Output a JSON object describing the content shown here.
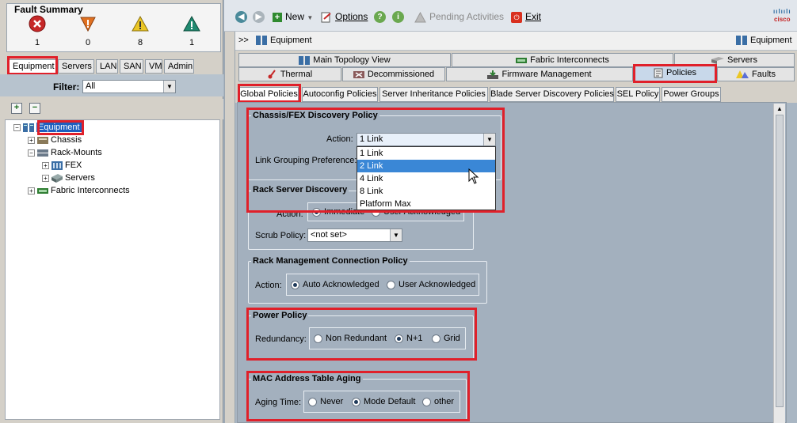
{
  "fault_summary": {
    "title": "Fault Summary",
    "items": [
      {
        "icon": "critical-icon",
        "count": "1",
        "color": "#c62828"
      },
      {
        "icon": "major-icon",
        "count": "0",
        "color": "#e07020"
      },
      {
        "icon": "minor-icon",
        "count": "8",
        "color": "#e8c020"
      },
      {
        "icon": "warning-icon",
        "count": "1",
        "color": "#1f8a70"
      }
    ]
  },
  "left_tabs": [
    "Equipment",
    "Servers",
    "LAN",
    "SAN",
    "VM",
    "Admin"
  ],
  "filter": {
    "label": "Filter:",
    "value": "All"
  },
  "tree": {
    "root": "Equipment",
    "chassis": "Chassis",
    "rack_mounts": "Rack-Mounts",
    "fex": "FEX",
    "servers": "Servers",
    "fabric": "Fabric Interconnects"
  },
  "toolbar": {
    "new": "New",
    "options": "Options",
    "pending": "Pending Activities",
    "exit": "Exit",
    "logo": "cisco"
  },
  "breadcrumb": {
    "prefix": ">>",
    "path": "Equipment",
    "right": "Equipment"
  },
  "tabs_row1": [
    "Main Topology View",
    "Fabric Interconnects",
    "Servers"
  ],
  "tabs_row2": [
    "Thermal",
    "Decommissioned",
    "Firmware Management",
    "Policies",
    "Faults"
  ],
  "subtabs": [
    "Global Policies",
    "Autoconfig Policies",
    "Server Inheritance Policies",
    "Blade Server Discovery Policies",
    "SEL Policy",
    "Power Groups"
  ],
  "chassis_policy": {
    "title": "Chassis/FEX Discovery Policy",
    "action_label": "Action:",
    "action_value": "1 Link",
    "link_grouping_label": "Link Grouping Preference:"
  },
  "dropdown": {
    "options": [
      "1 Link",
      "2 Link",
      "4 Link",
      "8 Link",
      "Platform Max"
    ],
    "highlighted": "2 Link"
  },
  "rack_discovery": {
    "title": "Rack Server Discovery",
    "action_label": "Action:",
    "options": [
      "Immediate",
      "User Acknowledged"
    ],
    "selected": "Immediate",
    "scrub_label": "Scrub Policy:",
    "scrub_value": "<not set>"
  },
  "rack_mgmt": {
    "title": "Rack Management Connection Policy",
    "action_label": "Action:",
    "options": [
      "Auto Acknowledged",
      "User Acknowledged"
    ],
    "selected": "Auto Acknowledged"
  },
  "power_policy": {
    "title": "Power Policy",
    "label": "Redundancy:",
    "options": [
      "Non Redundant",
      "N+1",
      "Grid"
    ],
    "selected": "N+1"
  },
  "mac_aging": {
    "title": "MAC Address Table Aging",
    "label": "Aging Time:",
    "options": [
      "Never",
      "Mode Default",
      "other"
    ],
    "selected": "Mode Default"
  }
}
